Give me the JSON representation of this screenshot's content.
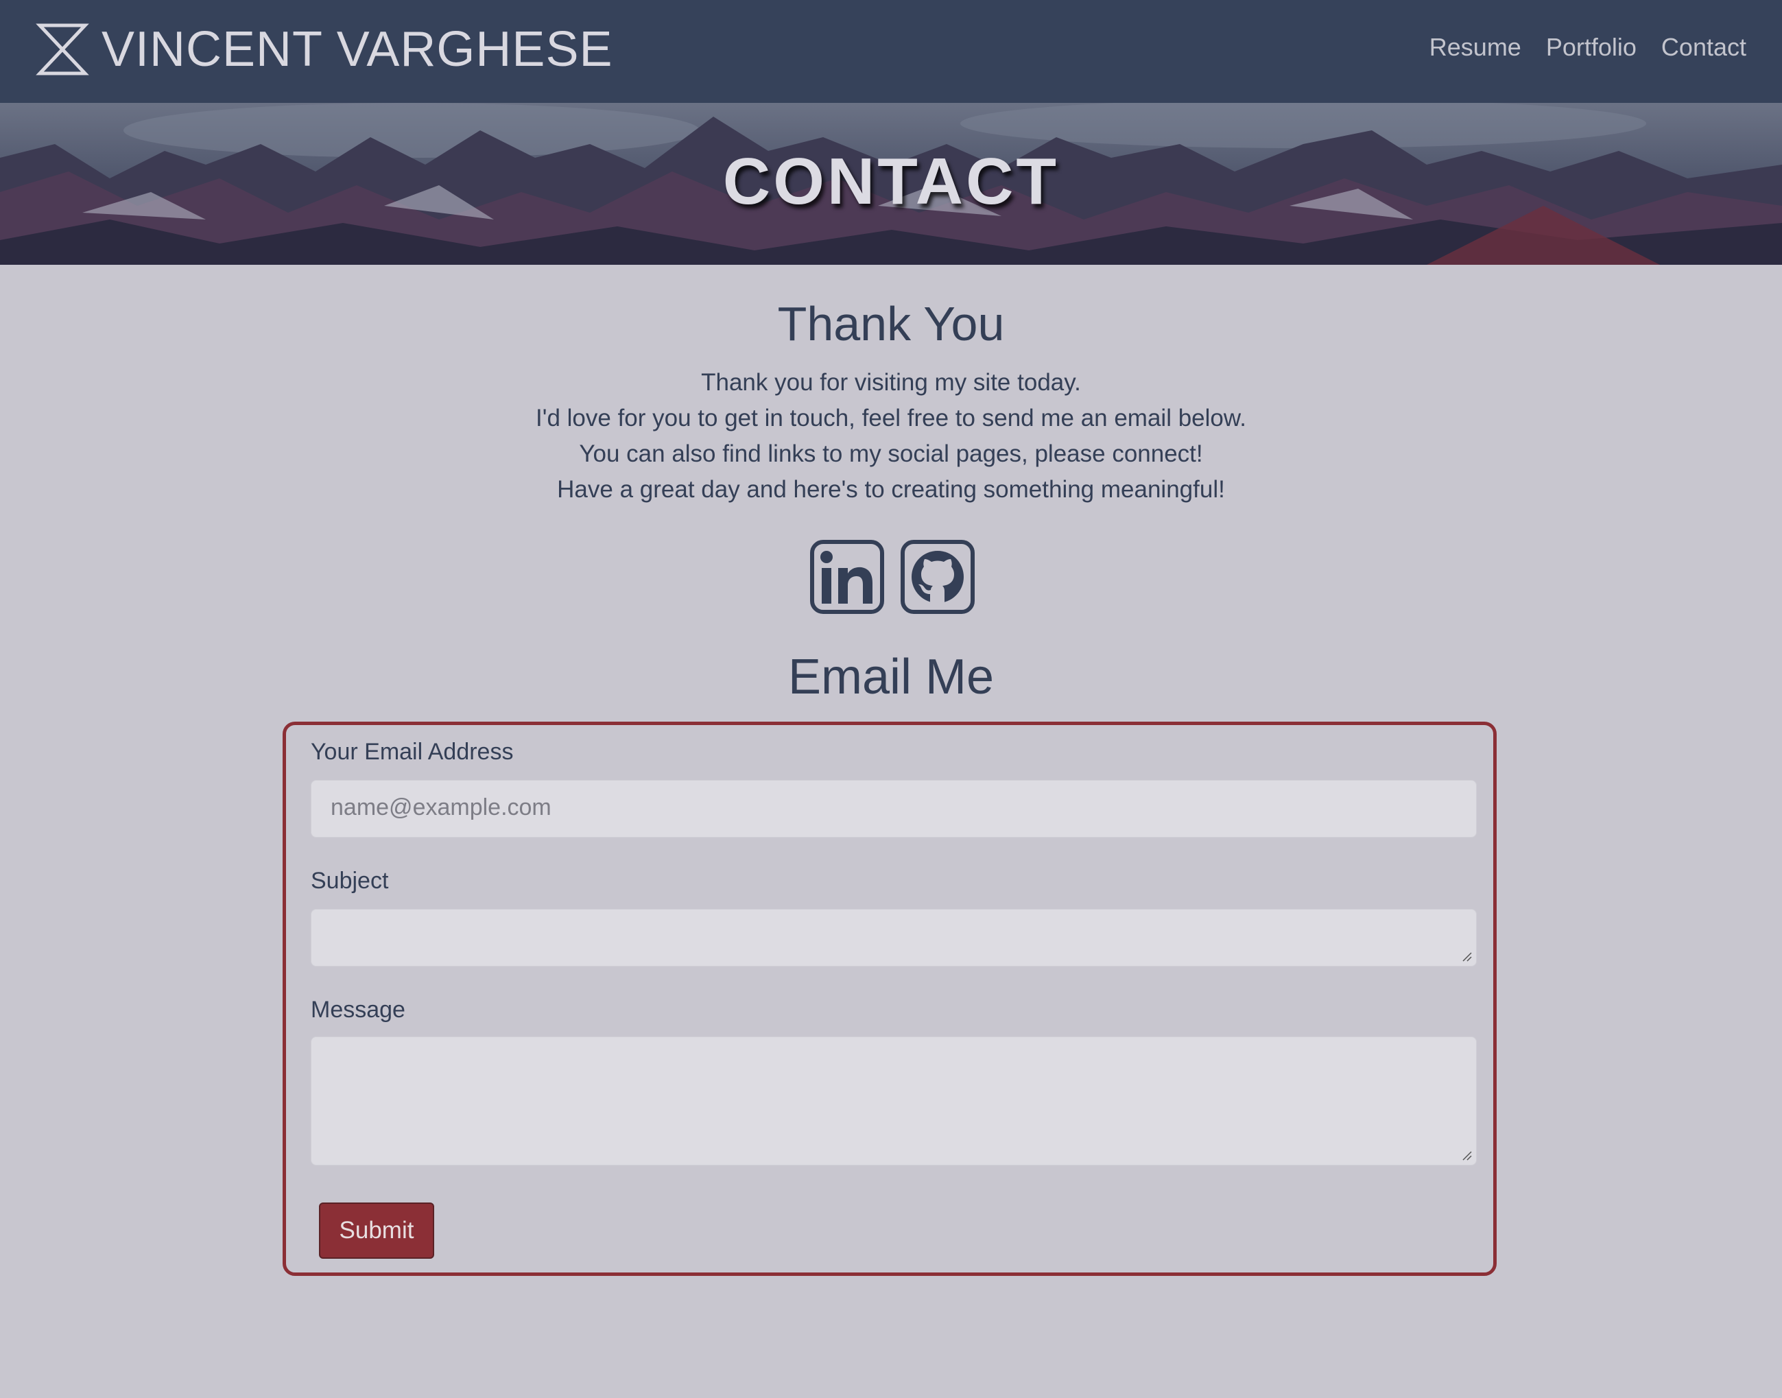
{
  "navbar": {
    "brand_name": "VINCENT VARGHESE",
    "brand_icon": "hourglass-logo-icon",
    "links": [
      {
        "label": "Resume"
      },
      {
        "label": "Portfolio"
      },
      {
        "label": "Contact"
      }
    ]
  },
  "hero": {
    "title": "CONTACT"
  },
  "thanks": {
    "heading": "Thank You",
    "lines": [
      "Thank you for visiting my site today.",
      "I'd love for you to get in touch, feel free to send me an email below.",
      "You can also find links to my social pages, please connect!",
      "Have a great day and here's to creating something meaningful!"
    ]
  },
  "social": {
    "icons": [
      "linkedin-icon",
      "github-icon"
    ]
  },
  "email_form": {
    "heading": "Email Me",
    "email_label": "Your Email Address",
    "email_placeholder": "name@example.com",
    "subject_label": "Subject",
    "subject_value": "",
    "message_label": "Message",
    "message_value": "",
    "submit_label": "Submit"
  },
  "colors": {
    "navbar_bg": "#36425a",
    "page_bg": "#c8c6cf",
    "accent": "#8b2f36",
    "text": "#343f56"
  }
}
